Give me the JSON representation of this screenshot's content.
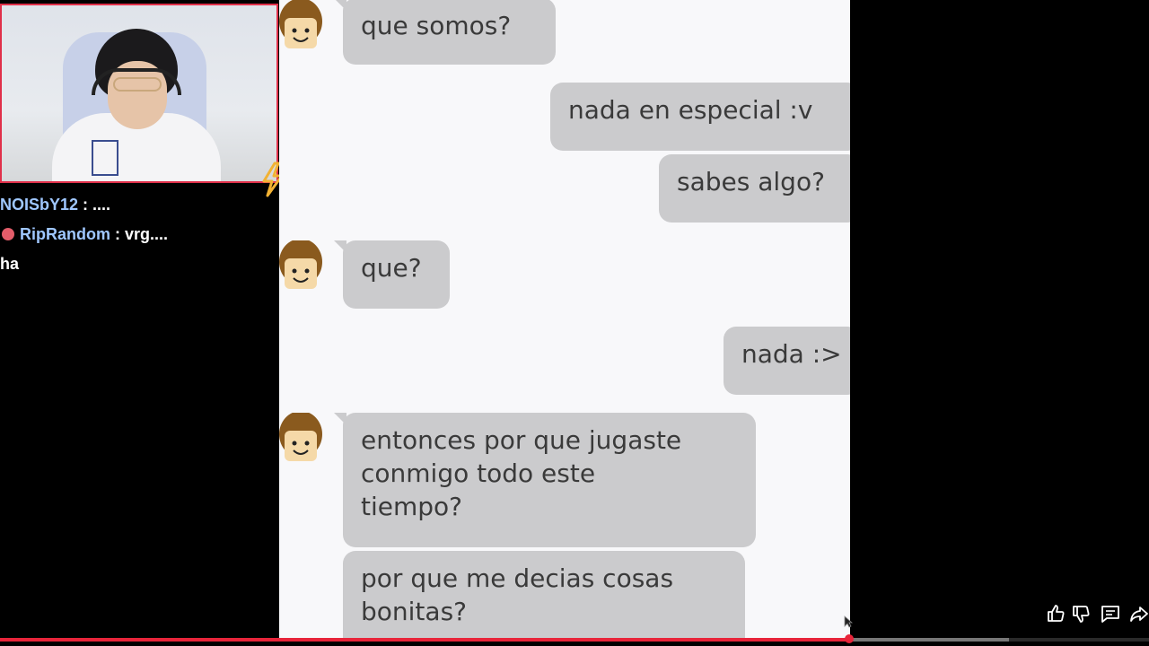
{
  "chat": [
    {
      "user": "NOISbY12",
      "sep": " : ",
      "msg": "....",
      "badge": false
    },
    {
      "user": "RipRandom",
      "sep": " : ",
      "msg": "vrg....",
      "badge": true
    },
    {
      "user": "",
      "sep": "",
      "msg": "ha",
      "badge": false
    }
  ],
  "messages": {
    "m1": "que somos?",
    "m2": "nada en especial :v",
    "m3": "sabes algo?",
    "m4": "que?",
    "m5": "nada :>",
    "m6": "entonces por que jugaste\nconmigo todo este\ntiempo?",
    "m7": "por que me decias cosas\nbonitas?"
  },
  "icons": [
    "bolt-icon",
    "like-icon",
    "dislike-icon",
    "comment-icon",
    "share-icon"
  ],
  "colors": {
    "accent": "#e8243a",
    "bubble": "#cbcbcd",
    "chat_user": "#9fc7ff",
    "cam_border": "#e0304a"
  },
  "progress": {
    "played_fraction": 0.739,
    "buffered_fraction": 0.878
  }
}
